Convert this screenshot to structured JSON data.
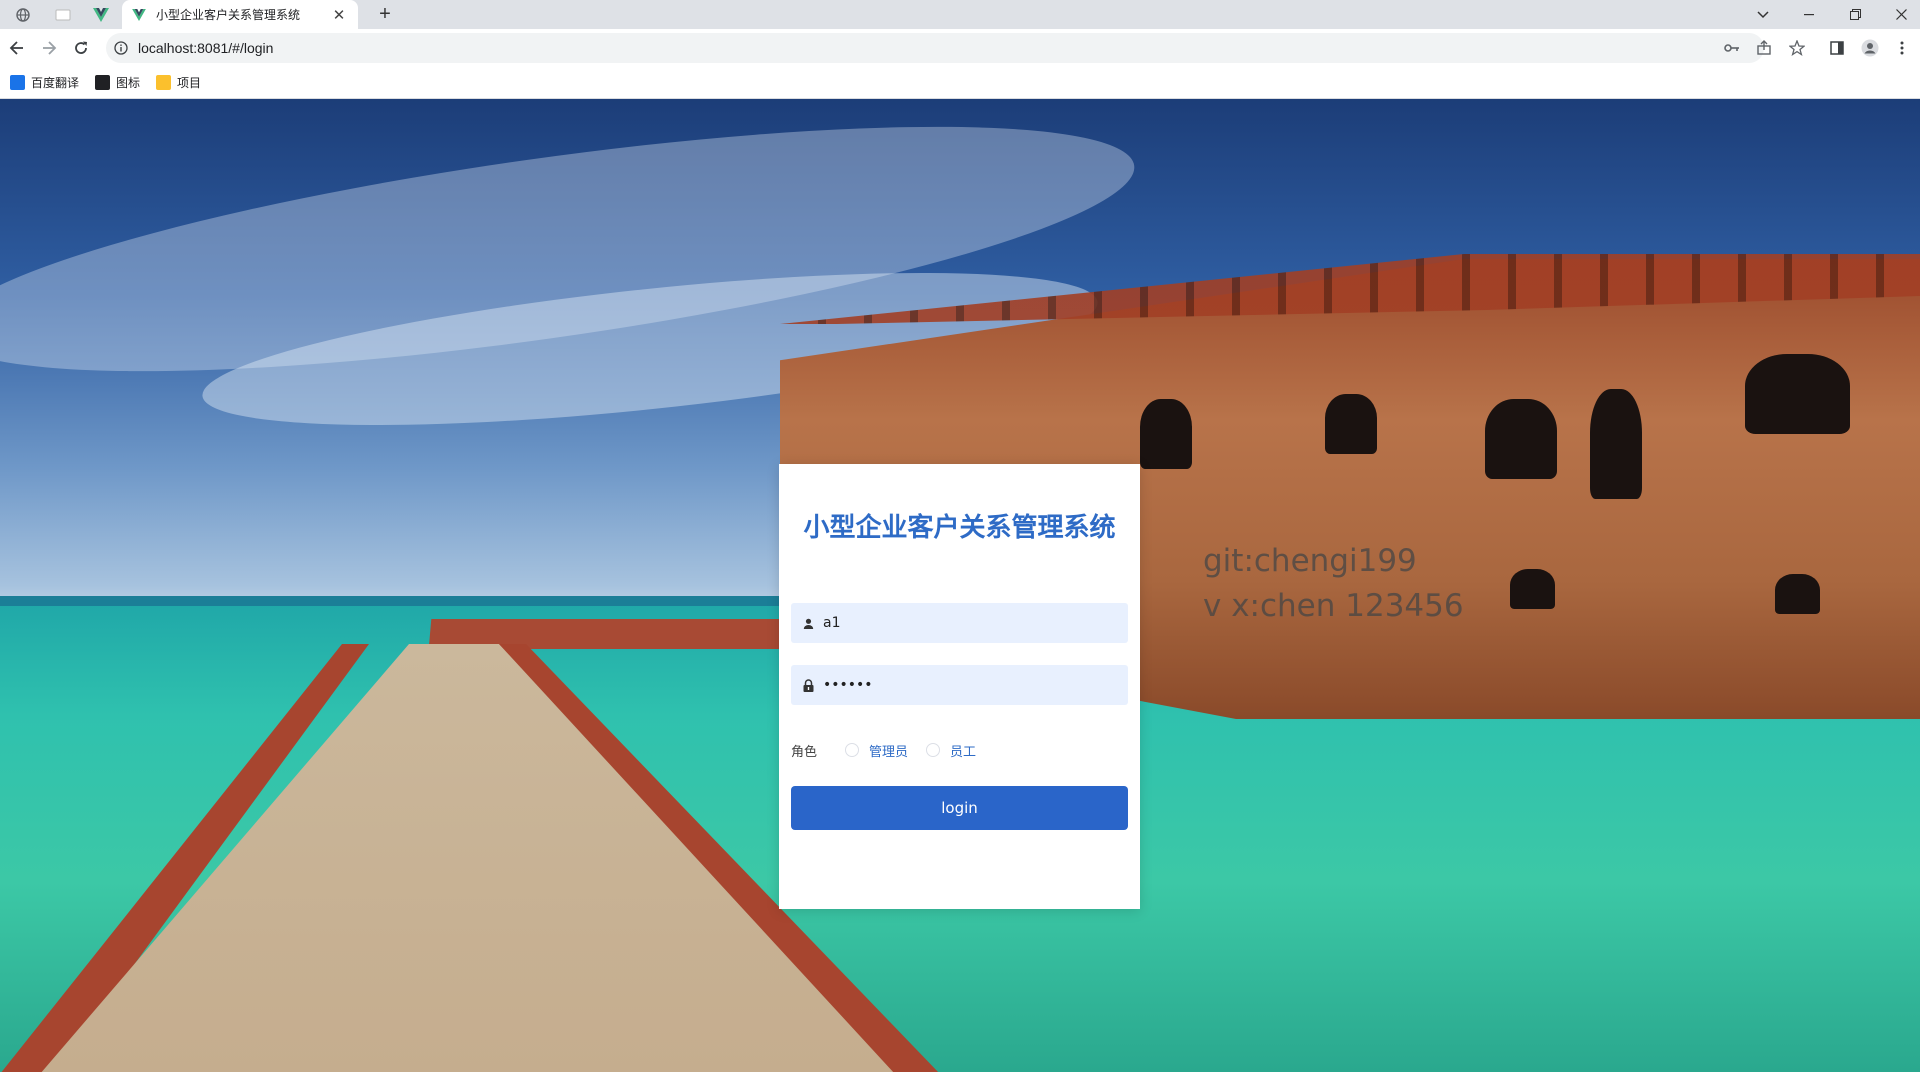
{
  "browser": {
    "tab_title": "小型企业客户关系管理系统",
    "tab_close": "✕",
    "new_tab": "+",
    "url": "localhost:8081/#/login",
    "bookmarks": [
      {
        "label": "百度翻译",
        "color": "#1a73e8"
      },
      {
        "label": "图标",
        "color": "#202124"
      },
      {
        "label": "项目",
        "color": "#fbc02d"
      }
    ]
  },
  "page": {
    "watermark_line1": "git:chengi199",
    "watermark_line2": "v x:chen  123456"
  },
  "login": {
    "title": "小型企业客户关系管理系统",
    "username_value": "a1",
    "password_value": "••••••",
    "role_label": "角色",
    "roles": [
      "管理员",
      "员工"
    ],
    "button_label": "login",
    "accent_color": "#2a65c9"
  }
}
